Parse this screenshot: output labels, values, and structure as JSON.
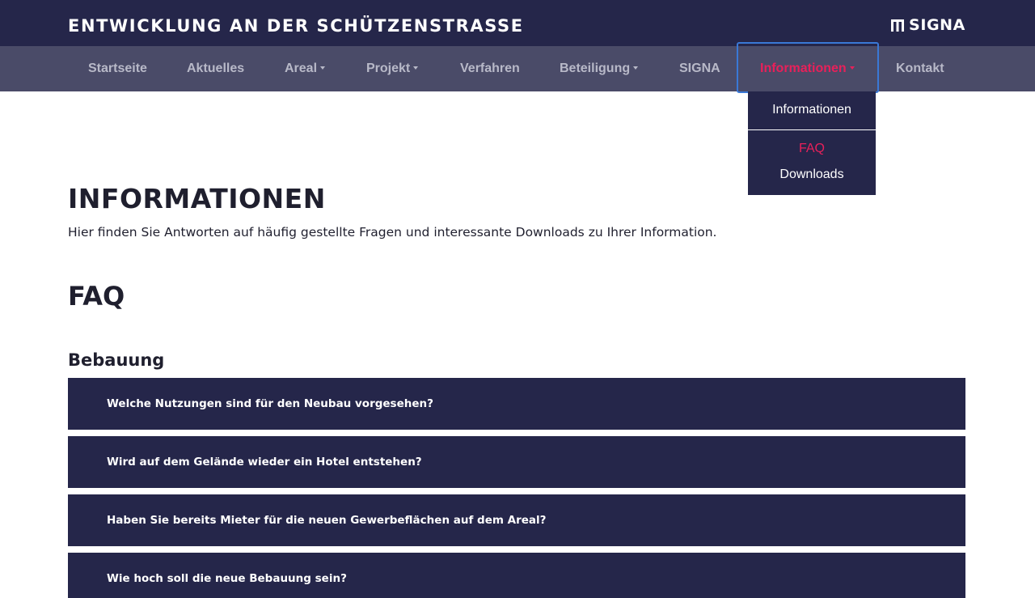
{
  "header": {
    "title": "ENTWICKLUNG AN DER SCHÜTZENSTRASSE",
    "logo_text": "SIGNA",
    "logo_icon": "signa-mark-icon"
  },
  "nav": {
    "items": [
      {
        "label": "Startseite"
      },
      {
        "label": "Aktuelles"
      },
      {
        "label": "Areal"
      },
      {
        "label": "Projekt"
      },
      {
        "label": "Verfahren"
      },
      {
        "label": "Beteiligung"
      },
      {
        "label": "SIGNA"
      },
      {
        "label": "Informationen"
      },
      {
        "label": "Kontakt"
      }
    ],
    "active": "Informationen",
    "active_color": "#e8205a"
  },
  "dropdown": {
    "items": [
      {
        "label": "Informationen"
      },
      {
        "label": "FAQ"
      },
      {
        "label": "Downloads"
      }
    ]
  },
  "main": {
    "title": "INFORMATIONEN",
    "intro": "Hier finden Sie Antworten auf häufig gestellte Fragen und interessante Downloads zu Ihrer Information.",
    "faq_title": "FAQ",
    "section_title": "Bebauung",
    "questions": [
      "Welche Nutzungen sind für den Neubau vorgesehen?",
      "Wird auf dem Gelände wieder ein Hotel entstehen?",
      "Haben Sie bereits Mieter für die neuen Gewerbeflächen auf dem Areal?",
      "Wie hoch soll die neue Bebauung sein?"
    ]
  },
  "colors": {
    "header_bg": "#25264a",
    "nav_bg": "#4a4b68",
    "accent": "#e8205a",
    "focus": "#3a78d6"
  }
}
